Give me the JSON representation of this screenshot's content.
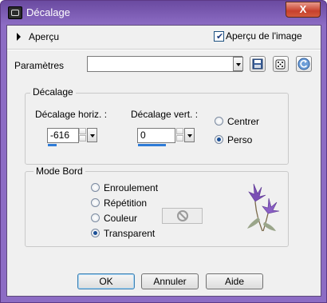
{
  "window": {
    "title": "Décalage",
    "close_label": "X"
  },
  "preview": {
    "label": "Aperçu",
    "image_preview_label": "Aperçu de l'image",
    "image_preview_checked": true
  },
  "presets": {
    "label": "Paramètres",
    "value": ""
  },
  "offset": {
    "group_label": "Décalage",
    "horizontal": {
      "label": "Décalage horiz. :",
      "value": "-616"
    },
    "vertical": {
      "label": "Décalage vert. :",
      "value": "0"
    },
    "center_label": "Centrer",
    "custom_label": "Perso",
    "selected": "Perso"
  },
  "edge_mode": {
    "group_label": "Mode Bord",
    "options": [
      "Enroulement",
      "Répétition",
      "Couleur",
      "Transparent"
    ],
    "selected": "Transparent"
  },
  "buttons": {
    "ok": "OK",
    "cancel": "Annuler",
    "help": "Aide"
  },
  "icons": {
    "title": "app-icon",
    "save": "save-icon",
    "random": "dice-icon",
    "reset": "reset-icon",
    "no_color": "no-symbol-icon",
    "decoration": "flower-icon"
  },
  "colors": {
    "titlebar": "#8c6cc4",
    "close": "#c7402c",
    "accent": "#2f7cd7"
  }
}
